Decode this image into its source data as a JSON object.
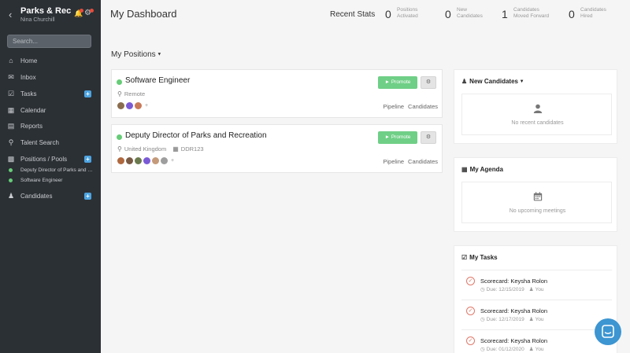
{
  "sidebar": {
    "title": "Parks & Rec",
    "user": "Nina Churchill",
    "search_placeholder": "Search...",
    "items": [
      {
        "label": "Home",
        "icon": "home-icon"
      },
      {
        "label": "Inbox",
        "icon": "inbox-icon"
      },
      {
        "label": "Tasks",
        "icon": "tasks-icon",
        "add": "+"
      },
      {
        "label": "Calendar",
        "icon": "calendar-icon"
      },
      {
        "label": "Reports",
        "icon": "reports-icon"
      },
      {
        "label": "Talent Search",
        "icon": "search-icon"
      },
      {
        "label": "Positions / Pools",
        "icon": "briefcase-icon",
        "add": "+"
      },
      {
        "label": "Candidates",
        "icon": "users-icon",
        "add": "+"
      }
    ],
    "positions": [
      "Deputy Director of Parks and Recreation",
      "Software Engineer"
    ]
  },
  "header": {
    "title": "My Dashboard",
    "stats_label": "Recent Stats",
    "stats": [
      {
        "value": "0",
        "line1": "Positions",
        "line2": "Activated"
      },
      {
        "value": "0",
        "line1": "New",
        "line2": "Candidates"
      },
      {
        "value": "1",
        "line1": "Candidates",
        "line2": "Moved Forward"
      },
      {
        "value": "0",
        "line1": "Candidates",
        "line2": "Hired"
      }
    ]
  },
  "positions": {
    "heading": "My Positions",
    "promote_label": "Promote",
    "pipeline_label": "Pipeline",
    "candidates_label": "Candidates",
    "avatar_more": "+",
    "cards": [
      {
        "title": "Software Engineer",
        "location": "Remote",
        "ref": "",
        "avatar_colors": [
          "#8a6d4e",
          "#7b5ad6",
          "#c97a5a"
        ]
      },
      {
        "title": "Deputy Director of Parks and Recreation",
        "location": "United Kingdom",
        "ref": "DDR123",
        "avatar_colors": [
          "#b0683f",
          "#7a5a44",
          "#6b7a4e",
          "#7b5ad6",
          "#c49a7a",
          "#9e9e9e"
        ]
      }
    ]
  },
  "panels": {
    "new_candidates": {
      "heading": "New Candidates",
      "empty": "No recent candidates"
    },
    "agenda": {
      "heading": "My Agenda",
      "empty": "No upcoming meetings"
    },
    "tasks": {
      "heading": "My Tasks",
      "you_label": "You",
      "items": [
        {
          "title": "Scorecard: Keysha Rolon",
          "due": "Due: 12/15/2019"
        },
        {
          "title": "Scorecard: Keysha Rolon",
          "due": "Due: 12/17/2019"
        },
        {
          "title": "Scorecard: Keysha Rolon",
          "due": "Due: 01/12/2020"
        }
      ]
    }
  },
  "colors": {
    "sidebar_bg": "#2b3035",
    "accent_green": "#6fcf86",
    "accent_blue": "#4ea4e0",
    "chat_button": "#3d95d1"
  }
}
